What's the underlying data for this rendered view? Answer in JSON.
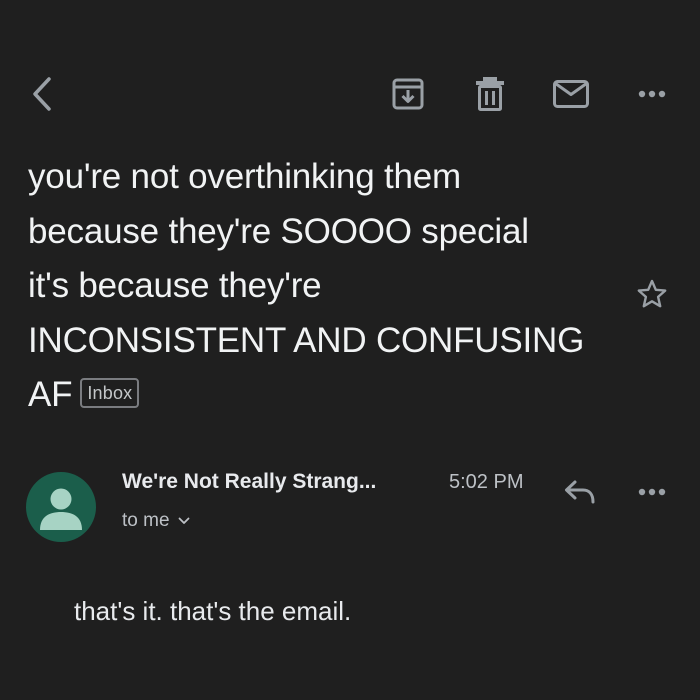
{
  "toolbar": {
    "back_icon": "arrow-back-icon",
    "archive_icon": "archive-icon",
    "delete_icon": "trash-icon",
    "mark_unread_icon": "mail-icon",
    "more_icon": "more-horizontal-icon"
  },
  "email": {
    "subject_lines": [
      "you're not overthinking them",
      "because they're SOOOO special",
      "it's because they're",
      "INCONSISTENT AND CONFUSING",
      "AF"
    ],
    "label": "Inbox",
    "starred": false
  },
  "message": {
    "sender": "We're Not Really Strang...",
    "time": "5:02 PM",
    "recipient": "to me",
    "body": "that's it. that's the email."
  },
  "colors": {
    "background": "#1f1f1f",
    "text": "#e8eaed",
    "icon": "#9aa0a6",
    "avatar_bg": "#1b5e4b",
    "avatar_fg": "#a7d3c4"
  }
}
